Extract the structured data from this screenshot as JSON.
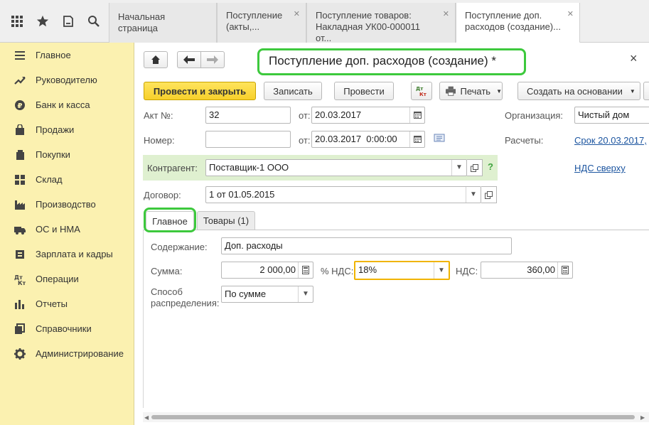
{
  "topbar": {
    "icons": [
      "apps-grid-icon",
      "star-icon",
      "history-icon",
      "search-icon"
    ],
    "tabs": [
      {
        "label": "Начальная страница"
      },
      {
        "label": "Поступление\n(акты,..."
      },
      {
        "label": "Поступление товаров:\nНакладная УК00-000011 от..."
      },
      {
        "label": "Поступление доп.\nрасходов (создание)..."
      }
    ]
  },
  "sidebar": {
    "items": [
      {
        "label": "Главное",
        "icon": "menu-icon"
      },
      {
        "label": "Руководителю",
        "icon": "trend-icon"
      },
      {
        "label": "Банк и касса",
        "icon": "coin-icon"
      },
      {
        "label": "Продажи",
        "icon": "bag-icon"
      },
      {
        "label": "Покупки",
        "icon": "cart-icon"
      },
      {
        "label": "Склад",
        "icon": "warehouse-icon"
      },
      {
        "label": "Производство",
        "icon": "factory-icon"
      },
      {
        "label": "ОС и НМА",
        "icon": "truck-icon"
      },
      {
        "label": "Зарплата и кадры",
        "icon": "people-icon"
      },
      {
        "label": "Операции",
        "icon": "dt-kt-icon"
      },
      {
        "label": "Отчеты",
        "icon": "bar-chart-icon"
      },
      {
        "label": "Справочники",
        "icon": "books-icon"
      },
      {
        "label": "Администрирование",
        "icon": "gear-icon"
      }
    ]
  },
  "form": {
    "title": "Поступление доп. расходов (создание) *",
    "close": "×",
    "toolbar": {
      "post_close": "Провести и закрыть",
      "save": "Записать",
      "post": "Провести",
      "dtkt": "Дт\nКт",
      "print": "Печать",
      "create_based": "Создать на основании"
    },
    "act_label": "Акт №:",
    "act_value": "32",
    "from_label": "от:",
    "act_date": "20.03.2017",
    "number_label": "Номер:",
    "number_value": "",
    "from_label2": "от:",
    "number_date": "20.03.2017  0:00:00",
    "org_label": "Организация:",
    "org_value": "Чистый дом",
    "settle_label": "Расчеты:",
    "settle_link": "Срок 20.03.2017,",
    "vat_link": "НДС сверху",
    "counterparty_label": "Контрагент:",
    "counterparty_value": "Поставщик-1 ООО",
    "help": "?",
    "contract_label": "Договор:",
    "contract_value": "1 от 01.05.2015",
    "tabs": [
      {
        "label": "Главное"
      },
      {
        "label": "Товары (1)"
      }
    ],
    "content_label": "Содержание:",
    "content_value": "Доп. расходы",
    "sum_label": "Сумма:",
    "sum_value": "2 000,00",
    "vat_rate_label": "% НДС:",
    "vat_rate_value": "18%",
    "vat_label": "НДС:",
    "vat_value": "360,00",
    "dist_label_1": "Способ",
    "dist_label_2": "распределения:",
    "dist_value": "По сумме"
  },
  "colors": {
    "sidebar_bg": "#fbf1b0",
    "primary_button": "#f7d02b",
    "highlight_outline": "#3dc93d",
    "focus_field": "#f0b400",
    "counterparty_bg": "#dff0d0",
    "link": "#1c55a0"
  }
}
